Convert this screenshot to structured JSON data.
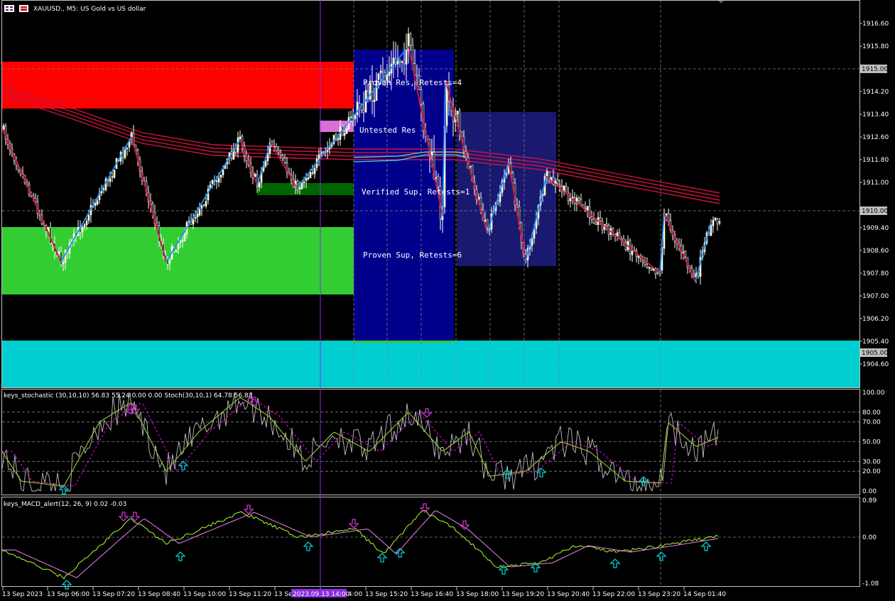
{
  "window": {
    "symbol_title": "XAUUSD., M5: US Gold vs US dollar"
  },
  "colors": {
    "background": "#000000",
    "grid": "#808080",
    "bull_body": "#ffffaa",
    "bear_body": "#000000",
    "wick": "#ffffff",
    "resistance_zone": "#ff0000",
    "support_zone": "#32cd32",
    "cyan_zone": "#00ced1",
    "proven_box": "#00008b",
    "verified_box": "#191970",
    "untested_res": "#da70d6",
    "verified_sup": "#006400",
    "zigzag_up": "#1e90ff",
    "zigzag_down": "#dc143c",
    "ma_red": "#c8143c",
    "ma_cyan": "#40e0d0",
    "stoch_main": "#c0c0c0",
    "stoch_signal": "#9acd32",
    "stoch_dash": "#ff00ff",
    "macd_main": "#adff2f",
    "macd_signal": "#ee82ee",
    "arrow_down": "#cc33cc",
    "arrow_up": "#00ced1",
    "vline": "#8a2be2"
  },
  "zones": {
    "proven_res": "Proven Res, Retests=4",
    "untested_res": "Untested Res",
    "verified_sup": "Verified Sup, Retests=1",
    "proven_sup": "Proven Sup, Retests=6"
  },
  "price_scale": {
    "ticks": [
      "1916.60",
      "1915.80",
      "1914.20",
      "1913.40",
      "1912.60",
      "1911.80",
      "1911.00",
      "1909.40",
      "1908.60",
      "1907.80",
      "1907.00",
      "1906.20",
      "1905.40",
      "1904.60"
    ],
    "marked": [
      "1915.00",
      "1910.00",
      "1905.00"
    ]
  },
  "stochastic": {
    "title": "keys_stochastic (30,10,10) 56.83 55.24 0.00 0.00 Stoch(30,10,1) 64.78 56.83",
    "ticks": [
      "100.00",
      "80.00",
      "70.00",
      "50.00",
      "30.00",
      "20.00",
      "0.00"
    ]
  },
  "macd": {
    "title": "keys_MACD_alert(12, 26, 9) 0.02 -0.03",
    "ticks": [
      "0.89",
      "0.00",
      "-1.08"
    ]
  },
  "time_axis": {
    "labels": [
      "13 Sep 2023",
      "13 Sep 06:00",
      "13 Sep 07:20",
      "13 Sep 08:40",
      "13 Sep 10:00",
      "13 Sep 11:20",
      "13 Sep 12:40",
      "13 Sep 14:00",
      "13 Sep 15:20",
      "13 Sep 16:40",
      "13 Sep 18:00",
      "13 Sep 19:20",
      "13 Sep 20:40",
      "13 Sep 22:00",
      "13 Sep 23:20",
      "14 Sep 01:40"
    ],
    "highlight": "2023.09.13 14:00"
  },
  "chart_data": {
    "type": "candlestick",
    "symbol": "XAUUSD.",
    "timeframe": "M5",
    "ylim": [
      1904.2,
      1917.0
    ],
    "zigzag_prices": [
      1912.9,
      1908.2,
      1912.6,
      1908.2,
      1912.5,
      1910.9,
      1912.4,
      1910.8,
      1915.8,
      1909.8,
      1914.6,
      1909.2,
      1911.7,
      1908.2,
      1911.2,
      1907.8,
      1909.9,
      1907.5,
      1909.6
    ]
  }
}
